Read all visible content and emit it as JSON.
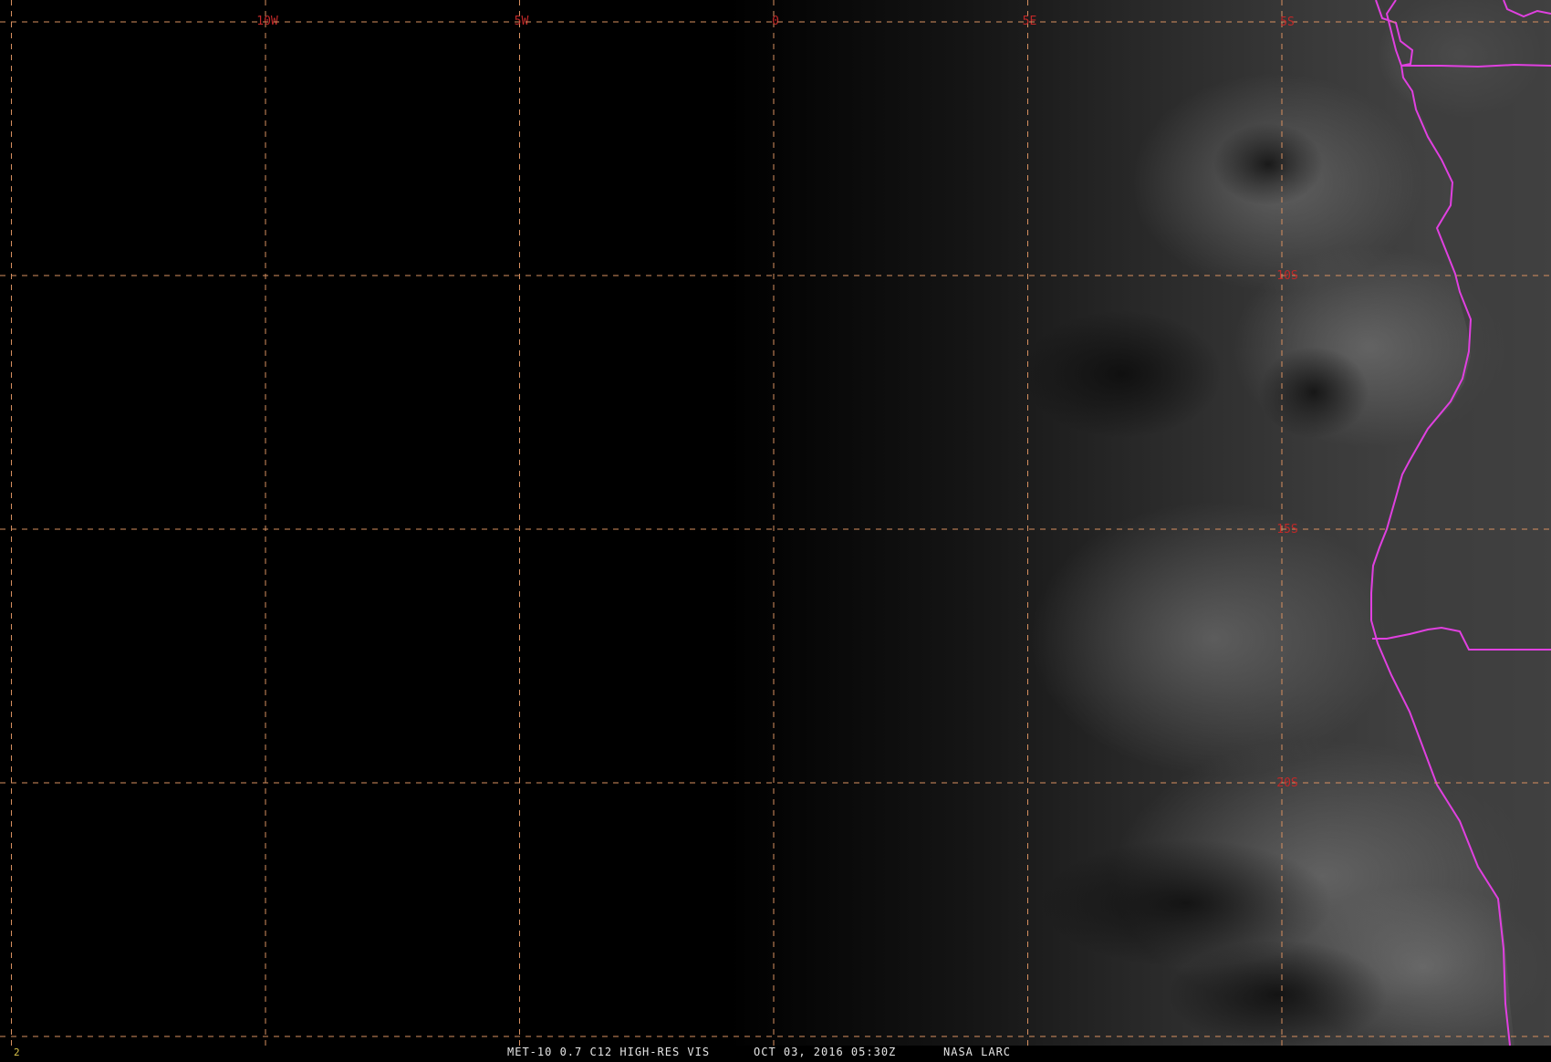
{
  "frame_number": "2",
  "footer": {
    "product": "MET-10 0.7 C12 HIGH-RES VIS",
    "datetime": "OCT 03, 2016 05:30Z",
    "source": "NASA LARC"
  },
  "graticule": {
    "longitudes": [
      {
        "value": -15,
        "label": ""
      },
      {
        "value": -10,
        "label": "10W"
      },
      {
        "value": -5,
        "label": "5W"
      },
      {
        "value": 0,
        "label": "0"
      },
      {
        "value": 5,
        "label": "5E"
      },
      {
        "value": 10,
        "label": ""
      }
    ],
    "latitudes": [
      {
        "value": -5,
        "label": "5S"
      },
      {
        "value": -10,
        "label": "10S"
      },
      {
        "value": -15,
        "label": "15S"
      },
      {
        "value": -20,
        "label": "20S"
      },
      {
        "value": -25,
        "label": ""
      }
    ],
    "line_color": "#d89060",
    "label_color": "#c02828"
  },
  "boundary_color": "#e040e0",
  "background_color": "#000000"
}
